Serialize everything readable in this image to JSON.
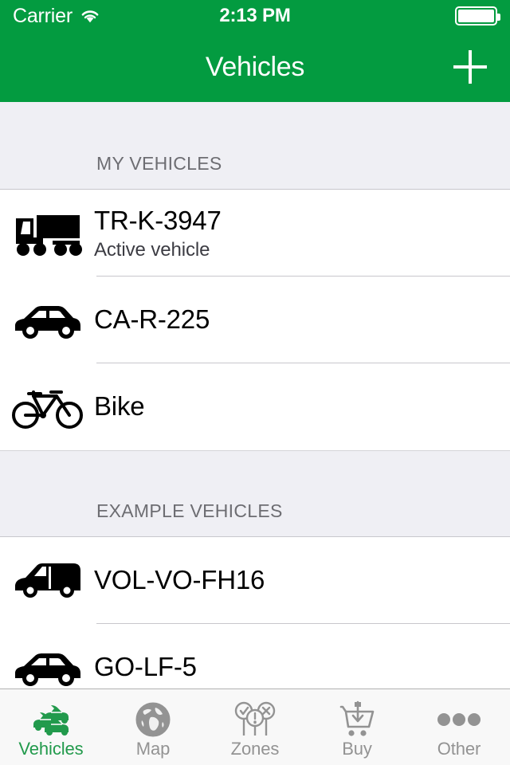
{
  "status_bar": {
    "carrier": "Carrier",
    "wifi_icon": "wifi-icon",
    "time": "2:13 PM",
    "battery_icon": "battery-full-icon"
  },
  "nav_bar": {
    "title": "Vehicles",
    "add_icon": "plus-icon",
    "background_color": "#039B40",
    "text_color": "#FFFFFF"
  },
  "sections": [
    {
      "header": "MY VEHICLES",
      "rows": [
        {
          "icon": "truck-icon",
          "title": "TR-K-3947",
          "subtitle": "Active vehicle"
        },
        {
          "icon": "car-icon",
          "title": "CA-R-225",
          "subtitle": ""
        },
        {
          "icon": "bicycle-icon",
          "title": "Bike",
          "subtitle": ""
        }
      ]
    },
    {
      "header": "EXAMPLE VEHICLES",
      "rows": [
        {
          "icon": "van-icon",
          "title": "VOL-VO-FH16",
          "subtitle": ""
        },
        {
          "icon": "car-icon",
          "title": "GO-LF-5",
          "subtitle": ""
        }
      ]
    }
  ],
  "tab_bar": {
    "active_color": "#229A4C",
    "inactive_color": "#939393",
    "tabs": [
      {
        "label": "Vehicles",
        "icon": "cars-icon",
        "active": true
      },
      {
        "label": "Map",
        "icon": "globe-icon",
        "active": false
      },
      {
        "label": "Zones",
        "icon": "zone-signs-icon",
        "active": false
      },
      {
        "label": "Buy",
        "icon": "shopping-cart-icon",
        "active": false
      },
      {
        "label": "Other",
        "icon": "ellipsis-icon",
        "active": false
      }
    ]
  }
}
